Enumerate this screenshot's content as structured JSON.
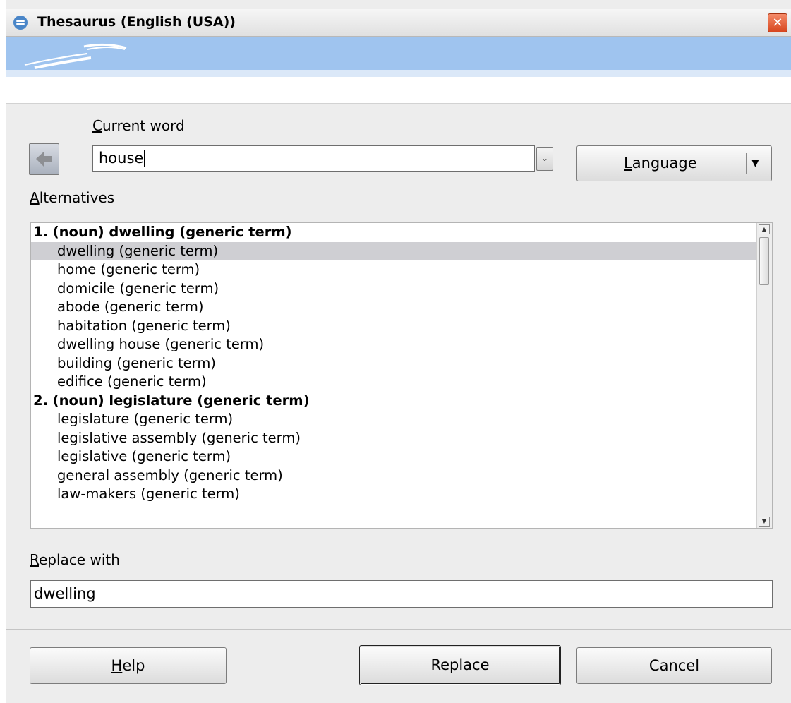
{
  "window": {
    "title": "Thesaurus (English (USA))",
    "close_glyph": "✕",
    "close_color": "#d7461e"
  },
  "current_word": {
    "label_accel": "C",
    "label_rest": "urrent word",
    "value": "house",
    "dropdown_glyph": "⌄"
  },
  "language_button": {
    "label_accel": "L",
    "label_rest": "anguage",
    "arrow_glyph": "▼"
  },
  "alternatives": {
    "label_accel": "A",
    "label_rest": "lternatives",
    "items": [
      {
        "text": "1. (noun) dwelling (generic term)",
        "header": true
      },
      {
        "text": "dwelling (generic term)",
        "selected": true
      },
      {
        "text": "home (generic term)"
      },
      {
        "text": "domicile (generic term)"
      },
      {
        "text": "abode (generic term)"
      },
      {
        "text": "habitation (generic term)"
      },
      {
        "text": "dwelling house (generic term)"
      },
      {
        "text": "building (generic term)"
      },
      {
        "text": "edifice (generic term)"
      },
      {
        "text": "2. (noun) legislature (generic term)",
        "header": true
      },
      {
        "text": "legislature (generic term)"
      },
      {
        "text": "legislative assembly (generic term)"
      },
      {
        "text": "legislative (generic term)"
      },
      {
        "text": "general assembly (generic term)"
      },
      {
        "text": "law-makers (generic term)"
      }
    ]
  },
  "replace_with": {
    "label_accel": "R",
    "label_rest": "eplace with",
    "value": "dwelling"
  },
  "buttons": {
    "help_accel": "H",
    "help_rest": "elp",
    "replace": "Replace",
    "cancel": "Cancel"
  },
  "icons": {
    "back": "arrow-left-icon",
    "app": "openoffice-icon",
    "banner": "gulls-logo"
  },
  "colors": {
    "banner": "#9fc4ef",
    "selection": "#cfcfd3"
  }
}
